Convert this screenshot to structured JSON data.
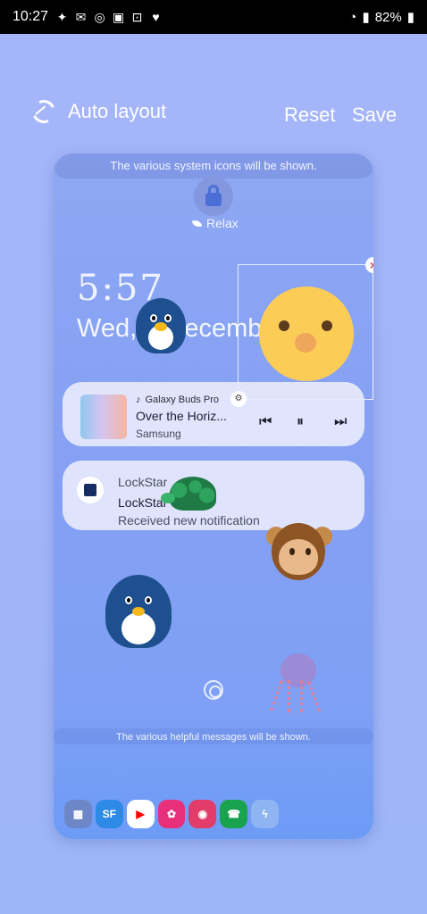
{
  "status_bar": {
    "time": "10:27",
    "battery": "82%",
    "notification_icons": [
      "twitter-icon",
      "gmail-icon",
      "instagram-icon",
      "gallery-icon",
      "lock-icon",
      "heart-icon"
    ]
  },
  "top_bar": {
    "auto_layout_label": "Auto layout",
    "reset_label": "Reset",
    "save_label": "Save"
  },
  "preview": {
    "system_icons_hint": "The various system icons will be shown.",
    "lock_status": "Relax",
    "clock": "5:57",
    "date": "Wed, 1 December",
    "media": {
      "source": "Galaxy Buds Pro",
      "title": "Over the Horiz...",
      "artist": "Samsung"
    },
    "notification": {
      "app": "LockStar",
      "title": "LockStar",
      "body": "Received new notification"
    },
    "helpful_hint": "The various helpful messages will be shown.",
    "dock_apps": [
      {
        "name": "apps",
        "label": ""
      },
      {
        "name": "sammy-fans",
        "label": "SF"
      },
      {
        "name": "youtube",
        "label": ""
      },
      {
        "name": "bixby-flower",
        "label": ""
      },
      {
        "name": "screen-recorder",
        "label": ""
      },
      {
        "name": "phone",
        "label": ""
      },
      {
        "name": "flashlight",
        "label": ""
      }
    ],
    "stickers": [
      "penguin",
      "chick",
      "turtle",
      "monkey",
      "penguin",
      "octopus"
    ],
    "colors": {
      "background": "#a5b5f9",
      "card": "#e6eafc",
      "accent": "#4b6fd6"
    }
  }
}
